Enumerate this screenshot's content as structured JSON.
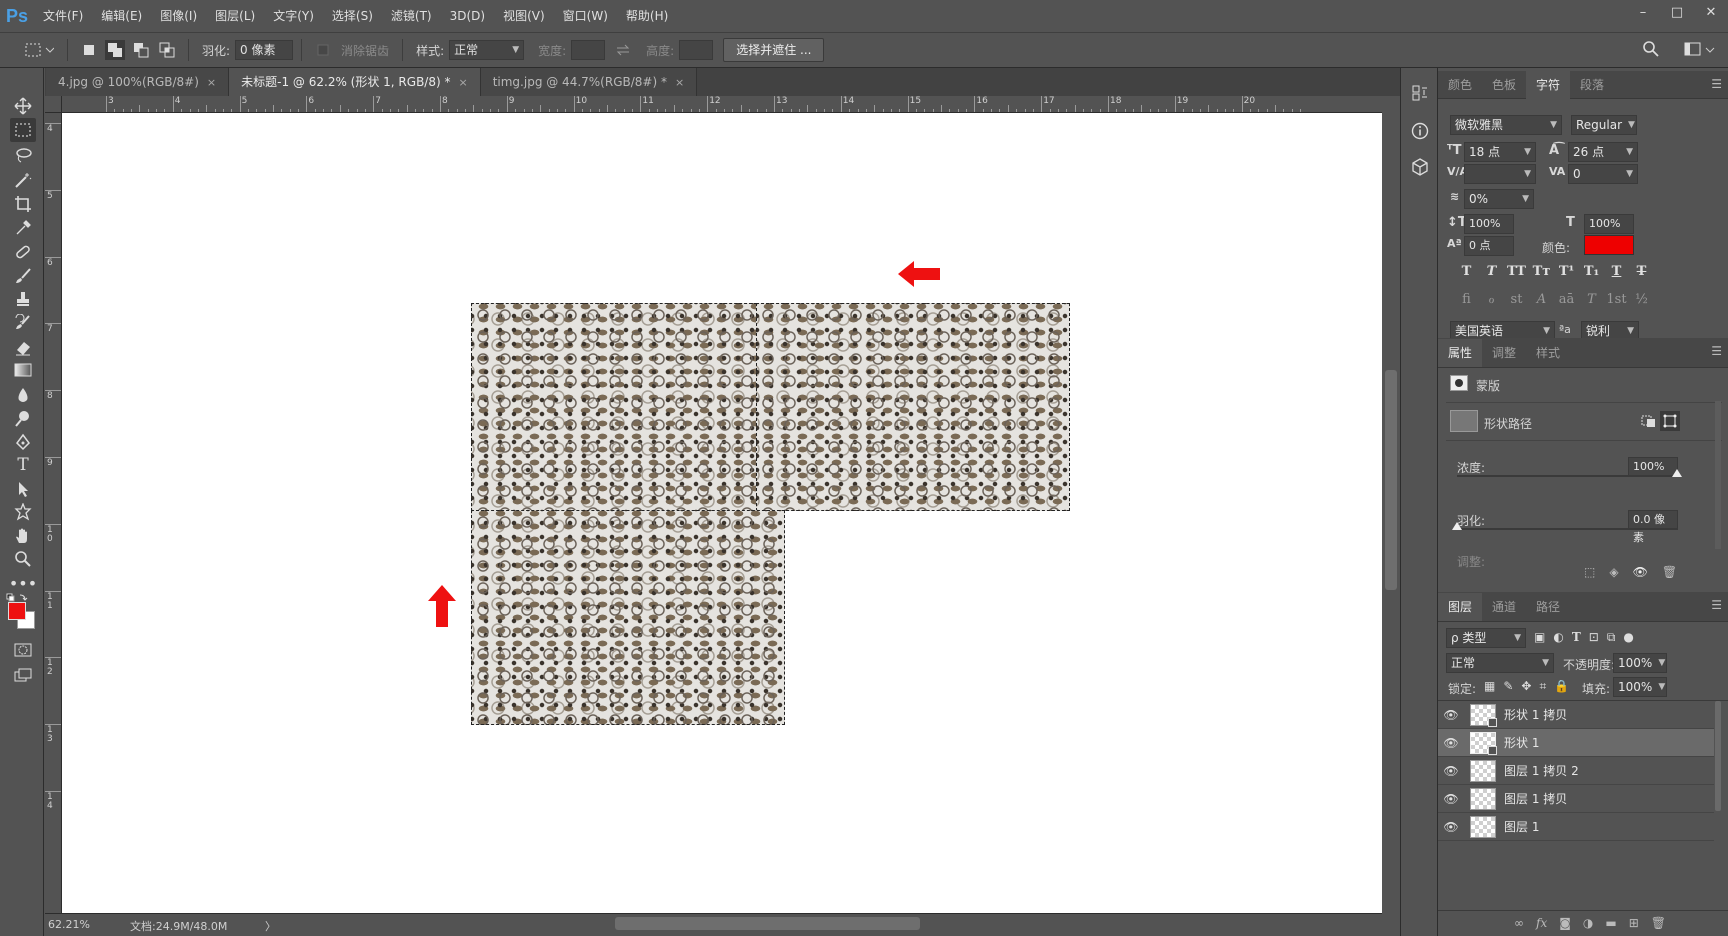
{
  "app": {
    "logo": "Ps"
  },
  "menu": [
    "文件(F)",
    "编辑(E)",
    "图像(I)",
    "图层(L)",
    "文字(Y)",
    "选择(S)",
    "滤镜(T)",
    "3D(D)",
    "视图(V)",
    "窗口(W)",
    "帮助(H)"
  ],
  "window_controls": {
    "minimize": "–",
    "maximize": "□",
    "close": "✕"
  },
  "options_bar": {
    "feather_label": "羽化:",
    "feather_value": "0 像素",
    "antialias_label": "消除锯齿",
    "style_label": "样式:",
    "style_value": "正常",
    "width_label": "宽度:",
    "height_label": "高度:",
    "select_mask_button": "选择并遮住 ..."
  },
  "tabs": [
    {
      "label": "4.jpg @ 100%(RGB/8#)",
      "active": false
    },
    {
      "label": "未标题-1 @ 62.2% (形状 1, RGB/8) *",
      "active": true
    },
    {
      "label": "timg.jpg @ 44.7%(RGB/8#) *",
      "active": false
    }
  ],
  "tab_close": "×",
  "ruler_top": [
    "3",
    "4",
    "5",
    "6",
    "7",
    "8",
    "9",
    "10",
    "11",
    "12",
    "13",
    "14",
    "15",
    "16",
    "17",
    "18",
    "19",
    "20"
  ],
  "ruler_left": [
    "4",
    "5",
    "6",
    "7",
    "8",
    "9",
    "10",
    "11",
    "12",
    "13",
    "14"
  ],
  "status": {
    "zoom": "62.21%",
    "doc_info": "文档:24.9M/48.0M",
    "arrow": "〉"
  },
  "colors": {
    "foreground": "#ee1111",
    "background": "#ffffff",
    "text_color": "#ee0000",
    "arrow": "#ee1111",
    "accent_logo": "#4aa0e6"
  },
  "character_panel": {
    "tabs": [
      "颜色",
      "色板",
      "字符",
      "段落"
    ],
    "active_tab": "字符",
    "font_family": "微软雅黑",
    "font_style": "Regular",
    "font_size": "18 点",
    "leading": "26 点",
    "kerning": "",
    "tracking": "0",
    "scale_percent": "0%",
    "vertical_scale": "100%",
    "horizontal_scale": "100%",
    "baseline_shift": "0 点",
    "color_label": "颜色:",
    "style_glyphs": [
      "T",
      "T",
      "TT",
      "Tт",
      "T¹",
      "T₁",
      "T",
      "T"
    ],
    "opentype_glyphs": [
      "fi",
      "ℴ",
      "st",
      "A",
      "aā",
      "T",
      "1st",
      "½"
    ],
    "language": "美国英语",
    "aa_icon": "ªa",
    "antialias": "锐利"
  },
  "properties_panel": {
    "tabs": [
      "属性",
      "调整",
      "样式"
    ],
    "active_tab": "属性",
    "mask_label": "蒙版",
    "shape_path_label": "形状路径",
    "density_label": "浓度:",
    "density_value": "100%",
    "density": 1.0,
    "feather_label": "羽化:",
    "feather_value": "0.0 像素",
    "feather": 0.0,
    "adjust_label": "调整:"
  },
  "layers_panel": {
    "tabs": [
      "图层",
      "通道",
      "路径"
    ],
    "active_tab": "图层",
    "filter_label": "ρ 类型",
    "blend_mode": "正常",
    "opacity_label": "不透明度:",
    "opacity_value": "100%",
    "lock_label": "锁定:",
    "fill_label": "填充:",
    "fill_value": "100%",
    "layers": [
      {
        "name": "形状 1 拷贝",
        "selected": false
      },
      {
        "name": "形状 1",
        "selected": true
      },
      {
        "name": "图层 1 拷贝 2",
        "selected": false
      },
      {
        "name": "图层 1 拷贝",
        "selected": false
      },
      {
        "name": "图层 1",
        "selected": false
      }
    ],
    "footer_icons": [
      "link-icon",
      "fx-icon",
      "mask-icon",
      "adjustment-icon",
      "folder-icon",
      "new-layer-icon",
      "trash-icon"
    ]
  },
  "icons": {
    "eye": "👁",
    "panel_menu": "☰",
    "chevron": "⌄",
    "search": "⌕"
  }
}
